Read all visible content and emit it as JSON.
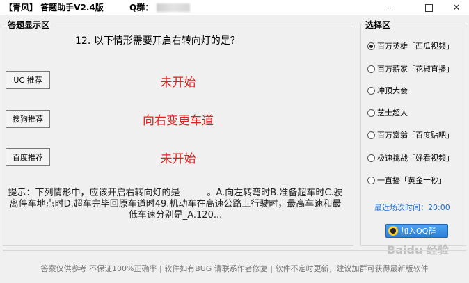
{
  "window": {
    "title": "【青风】 答题助手V2.4版",
    "qq_label": "Q群："
  },
  "answer_panel": {
    "legend": "答题显示区",
    "question": "12. 以下情形需要开启右转向灯的是？",
    "recommendations": [
      {
        "button": "UC 推荐",
        "answer": "未开始"
      },
      {
        "button": "搜狗推荐",
        "answer": "向右变更车道"
      },
      {
        "button": "百度推荐",
        "answer": "未开始"
      }
    ],
    "hint": "提示：下列情形中，应该开启右转向灯的是______。A.向左转弯时B.准备超车时C.驶离停车地点时D.超车完毕回原车道时49.机动车在高速公路上行驶时，最高车速和最低车速分别是_A.120..."
  },
  "select_panel": {
    "legend": "选择区",
    "options": [
      {
        "label": "百万英雄「西瓜视频」",
        "checked": true
      },
      {
        "label": "百万薪家「花椒直播」",
        "checked": false
      },
      {
        "label": "冲顶大会",
        "checked": false
      },
      {
        "label": "芝士超人",
        "checked": false
      },
      {
        "label": "百万富翁「百度贴吧」",
        "checked": false
      },
      {
        "label": "极速挑战「好看视频」",
        "checked": false
      },
      {
        "label": "一直播「黄金十秒」",
        "checked": false
      }
    ],
    "recent_time": "最近场次时间：20:00",
    "join_qq": "加入QQ群"
  },
  "watermark": "Baidu 经验",
  "footer": "答案仅供参考 不保证100%正确率 | 软件如有BUG 请联系作者修复 | 软件不定时更新，建议加群可获得最新版软件",
  "colors": {
    "answer": "#e41e1e",
    "recent": "#1e6fd0"
  }
}
